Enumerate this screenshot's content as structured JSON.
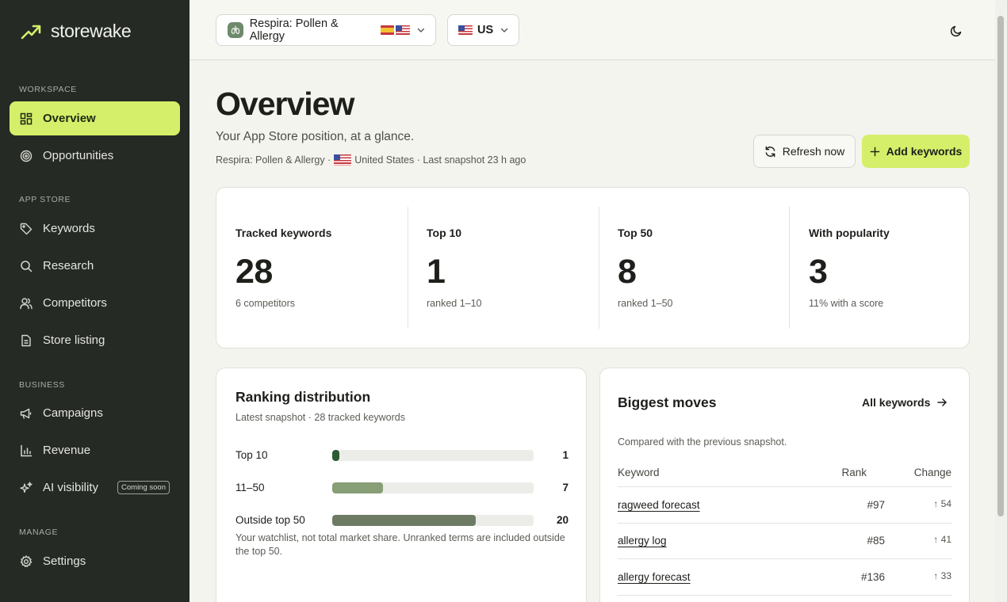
{
  "brand": {
    "name": "storewake"
  },
  "sidebar": {
    "sections": {
      "workspace": "WORKSPACE",
      "app_store": "APP STORE",
      "business": "BUSINESS",
      "manage": "MANAGE"
    },
    "items": {
      "overview": "Overview",
      "opportunities": "Opportunities",
      "keywords": "Keywords",
      "research": "Research",
      "competitors": "Competitors",
      "store_listing": "Store listing",
      "campaigns": "Campaigns",
      "revenue": "Revenue",
      "ai_visibility": "AI visibility",
      "settings": "Settings"
    },
    "ai_badge": "Coming soon",
    "active": "overview"
  },
  "topbar": {
    "app_name": "Respira: Pollen & Allergy",
    "country": "US"
  },
  "header": {
    "title": "Overview",
    "subtitle": "Your App Store position, at a glance.",
    "meta_app": "Respira: Pollen & Allergy ·",
    "meta_country": "United States · Last snapshot 23 h ago",
    "refresh_label": "Refresh now",
    "add_label": "Add keywords"
  },
  "stats": [
    {
      "label": "Tracked keywords",
      "value": "28",
      "note": "6 competitors"
    },
    {
      "label": "Top 10",
      "value": "1",
      "note": "ranked 1–10"
    },
    {
      "label": "Top 50",
      "value": "8",
      "note": "ranked 1–50"
    },
    {
      "label": "With popularity",
      "value": "3",
      "note": "11% with a score"
    }
  ],
  "distribution": {
    "title": "Ranking distribution",
    "subtitle": "Latest snapshot · 28 tracked keywords",
    "rows": [
      {
        "label": "Top 10",
        "count": "1",
        "fraction": 0.036,
        "color": "#2f5b34"
      },
      {
        "label": "11–50",
        "count": "7",
        "fraction": 0.25,
        "color": "#879e76"
      },
      {
        "label": "Outside top 50",
        "count": "20",
        "fraction": 0.714,
        "color": "#6e7b64"
      }
    ],
    "footnote": "Your watchlist, not total market share. Unranked terms are included outside the top 50."
  },
  "moves": {
    "title": "Biggest moves",
    "link": "All keywords",
    "subtitle": "Compared with the previous snapshot.",
    "columns": {
      "keyword": "Keyword",
      "rank": "Rank",
      "change": "Change"
    },
    "rows": [
      {
        "keyword": "ragweed forecast",
        "rank": "#97",
        "change": "54"
      },
      {
        "keyword": "allergy log",
        "rank": "#85",
        "change": "41"
      },
      {
        "keyword": "allergy forecast",
        "rank": "#136",
        "change": "33"
      }
    ]
  },
  "colors": {
    "accent": "#d6ef6a",
    "sidebar": "#262a25",
    "background": "#f4f4ef"
  }
}
